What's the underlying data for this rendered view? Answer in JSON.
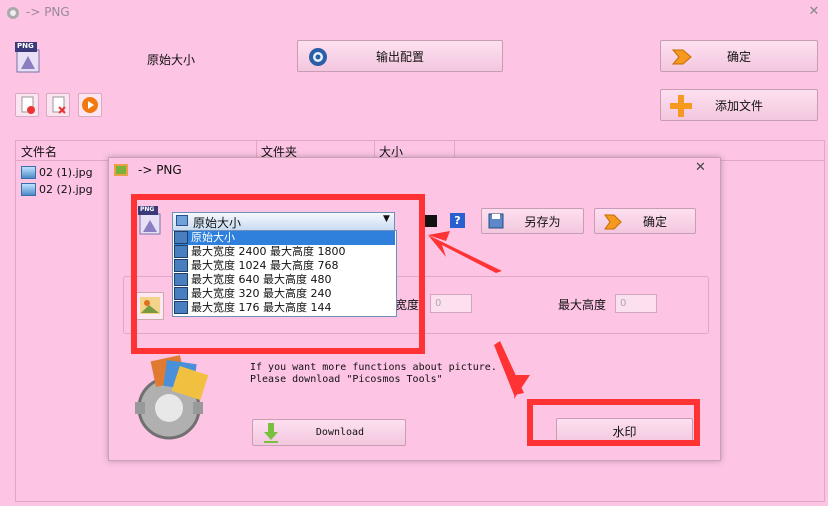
{
  "window": {
    "title": "-> PNG",
    "close_glyph": "✕"
  },
  "toolbar": {
    "format_badge": "PNG",
    "size_label": "原始大小",
    "output_config_label": "输出配置",
    "ok_label": "确定",
    "add_file_label": "添加文件"
  },
  "list": {
    "columns": [
      "文件名",
      "文件夹",
      "大小"
    ],
    "files": [
      "02 (1).jpg",
      "02 (2).jpg"
    ]
  },
  "dialog": {
    "title": "-> PNG",
    "close_glyph": "✕",
    "format_badge": "PNG",
    "combo_value": "原始大小",
    "dropdown_options": [
      "原始大小",
      "最大宽度 2400 最大高度 1800",
      "最大宽度 1024 最大高度 768",
      "最大宽度 640 最大高度 480",
      "最大宽度 320 最大高度 240",
      "最大宽度 176 最大高度 144"
    ],
    "save_as_label": "另存为",
    "ok_label": "确定",
    "help_label": "?",
    "width_label": "宽度",
    "width_value": "0",
    "height_label": "最大高度",
    "height_value": "0",
    "promo_line1": "If you want more functions about picture.",
    "promo_line2": "Please download \"Picosmos Tools\"",
    "download_label": "Download",
    "watermark_label": "水印"
  },
  "colors": {
    "background": "#fdc4e4",
    "annotation_red": "#ff3333",
    "selection_blue": "#2f7fdd"
  }
}
